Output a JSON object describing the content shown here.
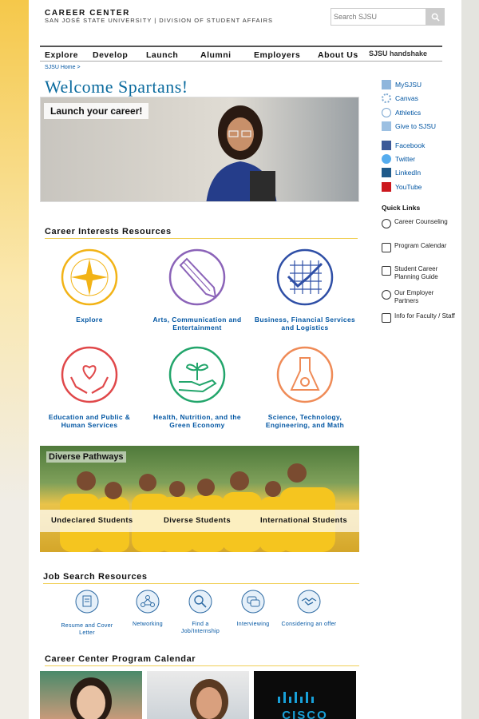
{
  "header": {
    "title": "CAREER CENTER",
    "subtitle": "SAN JOSÉ STATE UNIVERSITY | DIVISION OF STUDENT AFFAIRS",
    "search_placeholder": "Search SJSU"
  },
  "nav": {
    "items": [
      "Explore",
      "Develop",
      "Launch",
      "Alumni",
      "Employers",
      "About Us"
    ],
    "partner": "SJSU handshake"
  },
  "breadcrumb": "SJSU Home >",
  "welcome": "Welcome Spartans!",
  "hero": {
    "label": "Launch your career!"
  },
  "career_interests": {
    "title": "Career Interests Resources",
    "items": [
      {
        "label": "Explore",
        "icon": "compass-icon",
        "color": "#f2b316"
      },
      {
        "label": "Arts, Communication and Entertainment",
        "icon": "pencil-icon",
        "color": "#8b63b8"
      },
      {
        "label": "Business, Financial Services and Logistics",
        "icon": "chart-icon",
        "color": "#2f4fa6"
      },
      {
        "label": "Education and Public & Human Services",
        "icon": "hand-heart-icon",
        "color": "#e0484a"
      },
      {
        "label": "Health, Nutrition, and the Green Economy",
        "icon": "plant-icon",
        "color": "#22a56b"
      },
      {
        "label": "Science, Technology, Engineering, and Math",
        "icon": "flask-icon",
        "color": "#ef8b57"
      }
    ]
  },
  "pathways": {
    "title": "Diverse Pathways",
    "items": [
      "Undeclared Students",
      "Diverse Students",
      "International Students"
    ]
  },
  "job_search": {
    "title": "Job Search Resources",
    "items": [
      {
        "label": "Resume and Cover Letter",
        "icon": "document-icon"
      },
      {
        "label": "Networking",
        "icon": "network-icon"
      },
      {
        "label": "Find a Job/Internship",
        "icon": "magnifier-icon"
      },
      {
        "label": "Interviewing",
        "icon": "chat-icon"
      },
      {
        "label": "Considering an offer",
        "icon": "handshake-icon"
      }
    ]
  },
  "calendar": {
    "title": "Career Center Program Calendar",
    "logo_text": "CISCO"
  },
  "sidebar": {
    "links": [
      "MySJSU",
      "Canvas",
      "Athletics",
      "Give to SJSU"
    ],
    "social": [
      "Facebook",
      "Twitter",
      "LinkedIn",
      "YouTube"
    ],
    "quick_links_title": "Quick Links",
    "quick_links": [
      "Career Counseling",
      "Program Calendar",
      "Student Career Planning Guide",
      "Our Employer Partners",
      "Info for Faculty / Staff"
    ]
  },
  "colors": {
    "accent_blue": "#0055a2",
    "gold": "#f0cf55",
    "title_blue": "#0b6b9e"
  }
}
